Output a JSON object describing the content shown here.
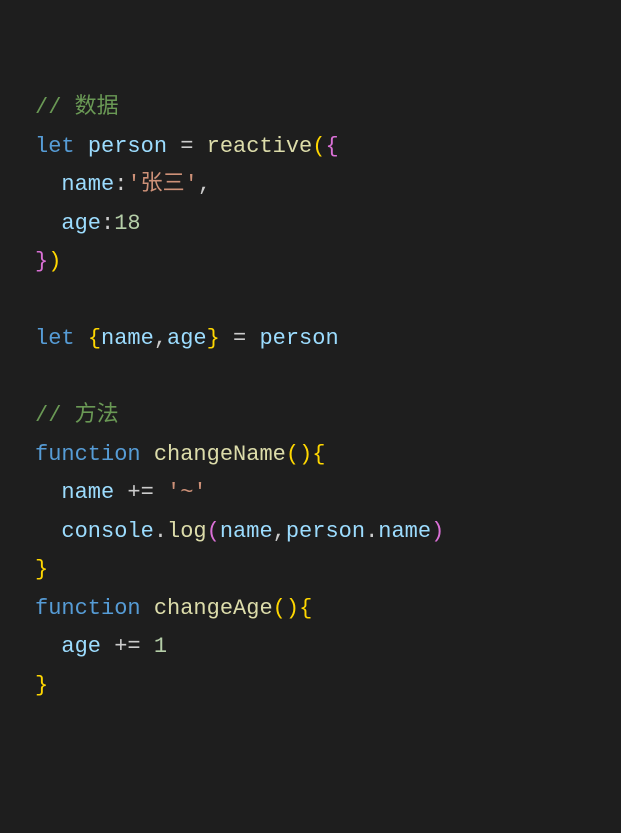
{
  "code": {
    "c1": "// 数据",
    "let1": "let",
    "person": "person",
    "eq": " = ",
    "reactive": "reactive",
    "lp1": "(",
    "lb1": "{",
    "name_key": "name",
    "colon": ":",
    "str1": "'张三'",
    "comma": ",",
    "age_key": "age",
    "num18": "18",
    "rb1": "}",
    "rp1": ")",
    "let2": "let",
    "lb2": "{",
    "name2": "name",
    "age2": "age",
    "rb2": "}",
    "person2": "person",
    "c2": "// 方法",
    "fn1": "function",
    "changeName": "changeName",
    "lp2": "(",
    "rp2": ")",
    "lb3": "{",
    "name3": "name",
    "pluseq": " += ",
    "str2": "'~'",
    "console": "console",
    "dot": ".",
    "log": "log",
    "lp3": "(",
    "name4": "name",
    "person3": "person",
    "name5": "name",
    "rp3": ")",
    "rb3": "}",
    "fn2": "function",
    "changeAge": "changeAge",
    "lp4": "(",
    "rp4": ")",
    "lb4": "{",
    "age3": "age",
    "num1": "1",
    "rb4": "}",
    "indent": "  ",
    "indent2": "    "
  }
}
